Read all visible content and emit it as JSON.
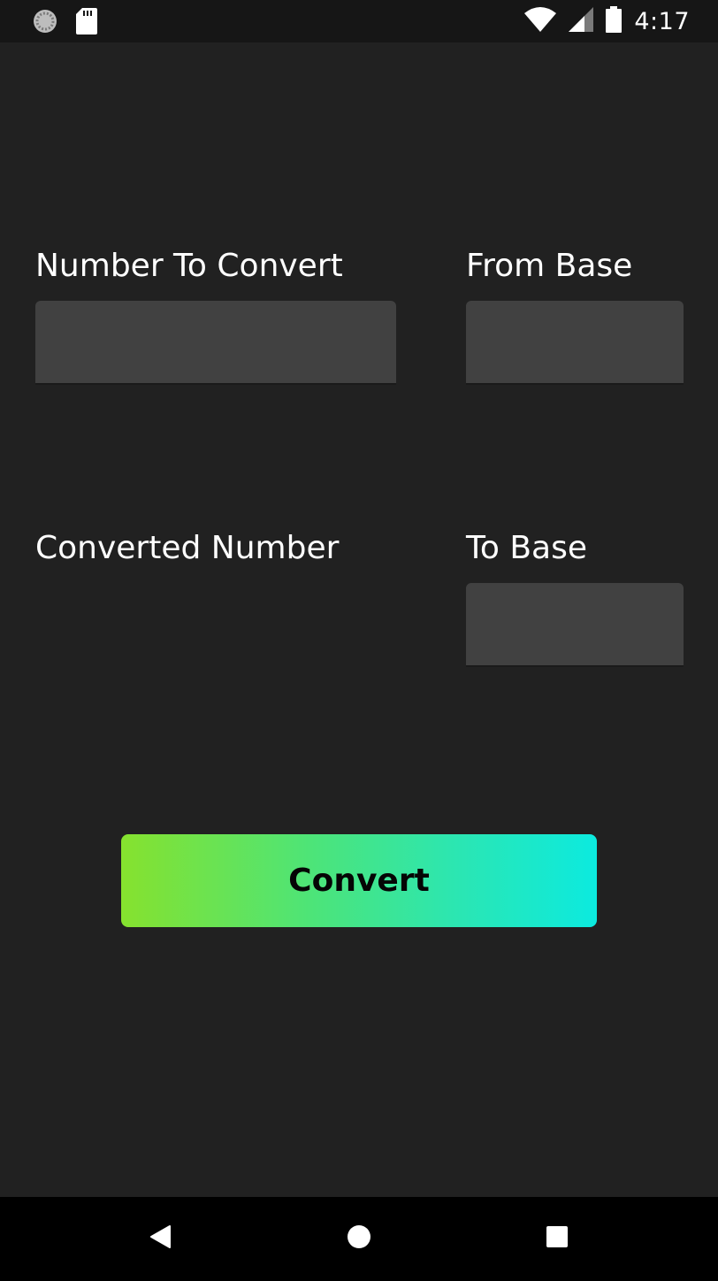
{
  "status_bar": {
    "time": "4:17",
    "icons": [
      "sync-icon",
      "sd-card-icon",
      "wifi-icon",
      "signal-icon",
      "battery-icon"
    ]
  },
  "form": {
    "number_label": "Number To Convert",
    "number_value": "",
    "from_base_label": "From Base",
    "from_base_value": "",
    "converted_label": "Converted Number",
    "converted_value": "",
    "to_base_label": "To Base",
    "to_base_value": ""
  },
  "convert_button": {
    "label": "Convert"
  },
  "nav_bar": {
    "icons": [
      "back-icon",
      "home-icon",
      "recents-icon"
    ]
  },
  "colors": {
    "background": "#212121",
    "field": "#414141",
    "button_gradient_start": "#86e22e",
    "button_gradient_end": "#0ceadf"
  }
}
